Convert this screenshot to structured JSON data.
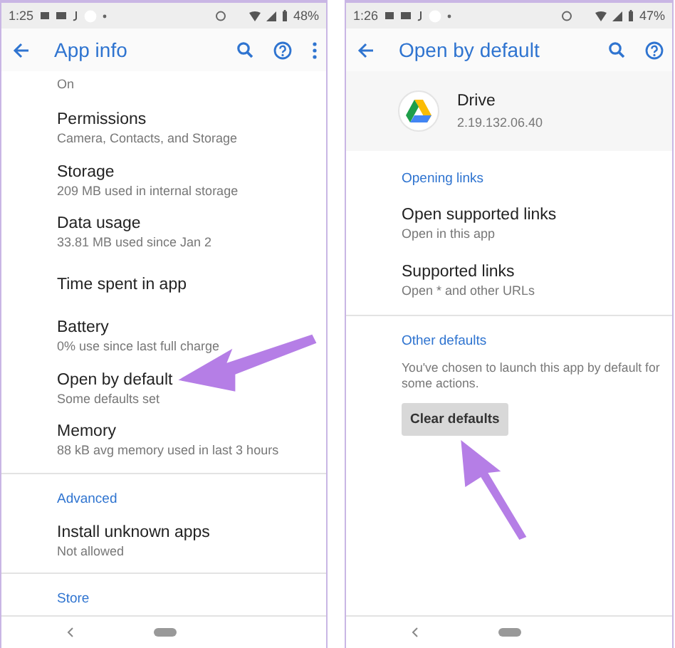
{
  "screens": [
    {
      "status_bar": {
        "time": "1:25",
        "battery": "48%"
      },
      "toolbar": {
        "title": "App info",
        "actions": [
          {
            "kind": "search"
          },
          {
            "kind": "help"
          },
          {
            "kind": "more"
          }
        ]
      },
      "items": [
        {
          "kind": "value",
          "text": "On"
        },
        {
          "kind": "setting",
          "title": "Permissions",
          "summary": "Camera, Contacts, and Storage"
        },
        {
          "kind": "setting",
          "title": "Storage",
          "summary": "209 MB used in internal storage"
        },
        {
          "kind": "setting",
          "title": "Data usage",
          "summary": "33.81 MB used since Jan 2"
        },
        {
          "kind": "setting",
          "title": "Time spent in app"
        },
        {
          "kind": "setting",
          "title": "Battery",
          "summary": "0% use since last full charge"
        },
        {
          "kind": "setting",
          "title": "Open by default",
          "summary": "Some defaults set",
          "pointed_at": true
        },
        {
          "kind": "setting",
          "title": "Memory",
          "summary": "88 kB avg memory used in last 3 hours"
        },
        {
          "kind": "divider"
        },
        {
          "kind": "section",
          "title": "Advanced"
        },
        {
          "kind": "setting",
          "title": "Install unknown apps",
          "summary": "Not allowed"
        },
        {
          "kind": "divider"
        },
        {
          "kind": "section",
          "title": "Store"
        }
      ]
    },
    {
      "status_bar": {
        "time": "1:26",
        "battery": "47%"
      },
      "toolbar": {
        "title": "Open by default",
        "actions": [
          {
            "kind": "search"
          },
          {
            "kind": "help"
          }
        ]
      },
      "items": [
        {
          "kind": "app_header",
          "title": "Drive",
          "summary": "2.19.132.06.40"
        },
        {
          "kind": "section",
          "title": "Opening links"
        },
        {
          "kind": "setting",
          "title": "Open supported links",
          "summary": "Open in this app"
        },
        {
          "kind": "setting",
          "title": "Supported links",
          "summary": "Open * and other URLs"
        },
        {
          "kind": "divider"
        },
        {
          "kind": "section",
          "title": "Other defaults"
        },
        {
          "kind": "description",
          "text": "You've chosen to launch this app by default for some actions."
        },
        {
          "kind": "button",
          "text": "Clear defaults",
          "pointed_at": true
        }
      ]
    }
  ]
}
